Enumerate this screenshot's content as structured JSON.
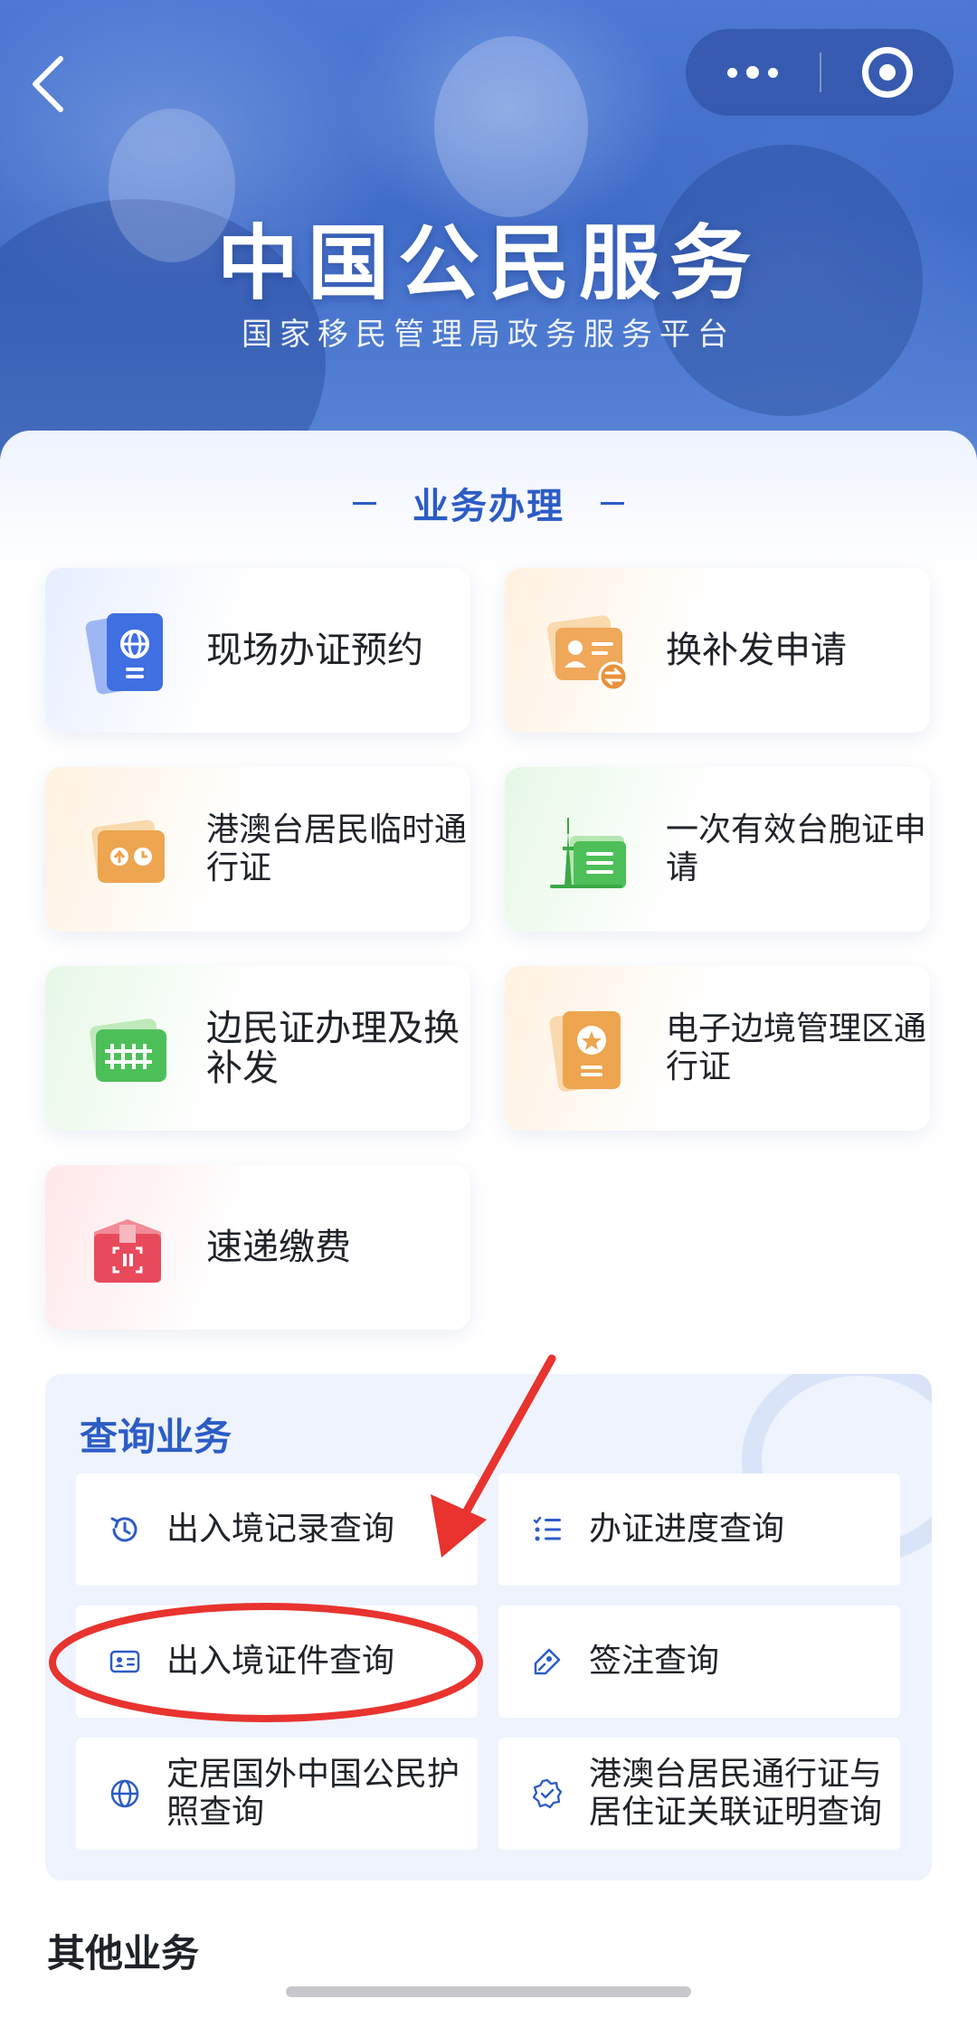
{
  "header": {
    "title": "中国公民服务",
    "subtitle": "国家移民管理局政务服务平台"
  },
  "nav": {
    "back_icon": "chevron-left-icon",
    "more_icon": "more-dots-icon",
    "close_icon": "target-ring-icon"
  },
  "business": {
    "section_title": "业务办理",
    "cards": [
      {
        "label": "现场办证预约",
        "icon": "passport-globe-icon",
        "tint": "#e7eeff"
      },
      {
        "label": "换补发申请",
        "icon": "id-card-exchange-icon",
        "tint": "#fff1df"
      },
      {
        "label": "港澳台居民临时通行证",
        "icon": "permit-clock-icon",
        "tint": "#fff1df"
      },
      {
        "label": "一次有效台胞证申请",
        "icon": "tower-permit-icon",
        "tint": "#e6f8e6"
      },
      {
        "label": "边民证办理及换补发",
        "icon": "border-fence-icon",
        "tint": "#e6f8e6"
      },
      {
        "label": "电子边境管理区通行证",
        "icon": "badge-document-icon",
        "tint": "#fff1df"
      },
      {
        "label": "速递缴费",
        "icon": "package-scan-icon",
        "tint": "#ffe7e9"
      }
    ]
  },
  "query": {
    "section_title": "查询业务",
    "items": [
      {
        "label": "出入境记录查询",
        "icon": "history-icon"
      },
      {
        "label": "办证进度查询",
        "icon": "checklist-icon"
      },
      {
        "label": "出入境证件查询",
        "icon": "id-card-icon"
      },
      {
        "label": "签注查询",
        "icon": "tag-pen-icon"
      },
      {
        "label": "定居国外中国公民护照查询",
        "icon": "globe-icon"
      },
      {
        "label": "港澳台居民通行证与居住证关联证明查询",
        "icon": "verified-badge-icon"
      }
    ]
  },
  "other": {
    "section_title": "其他业务"
  },
  "colors": {
    "accent": "#2c5cc5",
    "annotation": "#e8332f"
  }
}
